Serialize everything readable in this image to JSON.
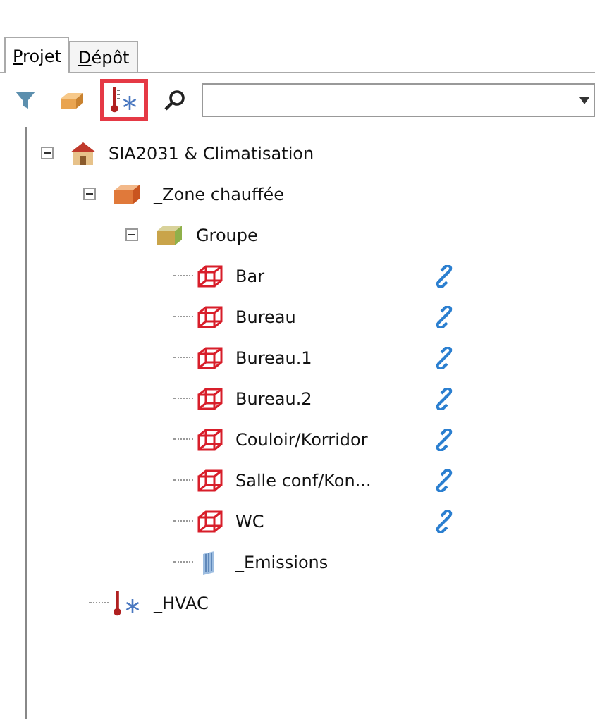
{
  "tabs": [
    {
      "label": "Projet",
      "selected": true
    },
    {
      "label": "Dépôt",
      "selected": false
    }
  ],
  "toolbar": {
    "buttons": [
      {
        "kind": "filter",
        "selected": false
      },
      {
        "kind": "box",
        "selected": false
      },
      {
        "kind": "hvac",
        "selected": true
      },
      {
        "kind": "search",
        "selected": false
      }
    ]
  },
  "tree": [
    {
      "label": "SIA2031 & Climatisation",
      "kind": "house",
      "expanded": true,
      "children": [
        {
          "label": "_Zone chauffée",
          "kind": "zone",
          "expanded": true,
          "children": [
            {
              "label": "Groupe",
              "kind": "group",
              "expanded": true,
              "children": [
                {
                  "label": "Bar",
                  "kind": "room",
                  "linked": true
                },
                {
                  "label": "Bureau",
                  "kind": "room",
                  "linked": true
                },
                {
                  "label": "Bureau.1",
                  "kind": "room",
                  "linked": true
                },
                {
                  "label": "Bureau.2",
                  "kind": "room",
                  "linked": true
                },
                {
                  "label": "Couloir/Korridor",
                  "kind": "room",
                  "linked": true
                },
                {
                  "label": "Salle conf/Kon...",
                  "kind": "room",
                  "linked": true
                },
                {
                  "label": "WC",
                  "kind": "room",
                  "linked": true
                },
                {
                  "label": "_Emissions",
                  "kind": "emitter",
                  "linked": false
                }
              ]
            }
          ]
        },
        {
          "label": "_HVAC",
          "kind": "hvac"
        }
      ]
    }
  ]
}
